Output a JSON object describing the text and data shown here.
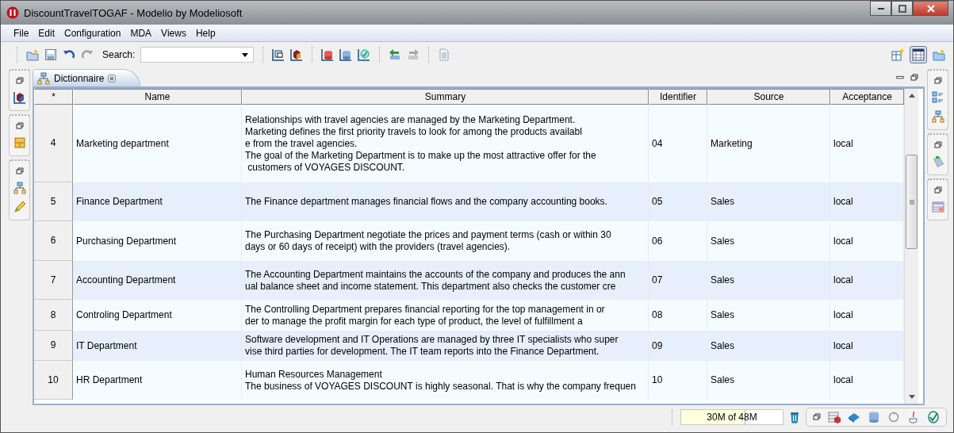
{
  "window": {
    "title": "DiscountTravelTOGAF - Modelio by Modeliosoft"
  },
  "menu": [
    "File",
    "Edit",
    "Configuration",
    "MDA",
    "Views",
    "Help"
  ],
  "toolbar": {
    "search_label": "Search:"
  },
  "editor_tab": {
    "label": "Dictionnaire",
    "selected": true
  },
  "table": {
    "columns": [
      "*",
      "Name",
      "Summary",
      "Identifier",
      "Source",
      "Acceptance"
    ],
    "rows": [
      {
        "index": "4",
        "name": "Marketing department",
        "summary": "Relationships with travel agencies are managed by the Marketing Department.\nMarketing defines the first priority travels to look for among the products availabl\ne from the travel agencies.\nThe goal of the Marketing Department is to make up the most attractive offer for the\n customers of VOYAGES DISCOUNT.",
        "identifier": "04",
        "source": "Marketing",
        "acceptance": "local"
      },
      {
        "index": "5",
        "name": "Finance Department",
        "summary": "The Finance department manages financial flows and the company accounting books.",
        "identifier": "05",
        "source": "Sales",
        "acceptance": "local"
      },
      {
        "index": "6",
        "name": "Purchasing Department",
        "summary": "The Purchasing Department negotiate the prices and payment terms (cash or within 30\ndays or 60 days of receipt) with the providers (travel agencies).",
        "identifier": "06",
        "source": "Sales",
        "acceptance": "local"
      },
      {
        "index": "7",
        "name": "Accounting Department",
        "summary": "The Accounting Department maintains the accounts of the company and produces the ann\nual balance sheet and income statement. This department also checks the customer cre",
        "identifier": "07",
        "source": "Sales",
        "acceptance": "local"
      },
      {
        "index": "8",
        "name": "Controling Department",
        "summary": "The Controlling Department prepares financial reporting for the top management in or\nder to manage the profit margin for each type of product, the level of fulfillment a",
        "identifier": "08",
        "source": "Sales",
        "acceptance": "local"
      },
      {
        "index": "9",
        "name": "IT Department",
        "summary": "Software development and IT Operations are managed by three IT specialists who super\nvise third parties for development. The IT team reports into the Finance Department.",
        "identifier": "09",
        "source": "Sales",
        "acceptance": "local"
      },
      {
        "index": "10",
        "name": "HR Department",
        "summary": "Human Resources Management\nThe business of VOYAGES DISCOUNT is highly seasonal. That is why the company frequen",
        "identifier": "10",
        "source": "Sales",
        "acceptance": "local"
      }
    ]
  },
  "status_bar": {
    "memory": "30M of 48M",
    "level": 0.625
  }
}
